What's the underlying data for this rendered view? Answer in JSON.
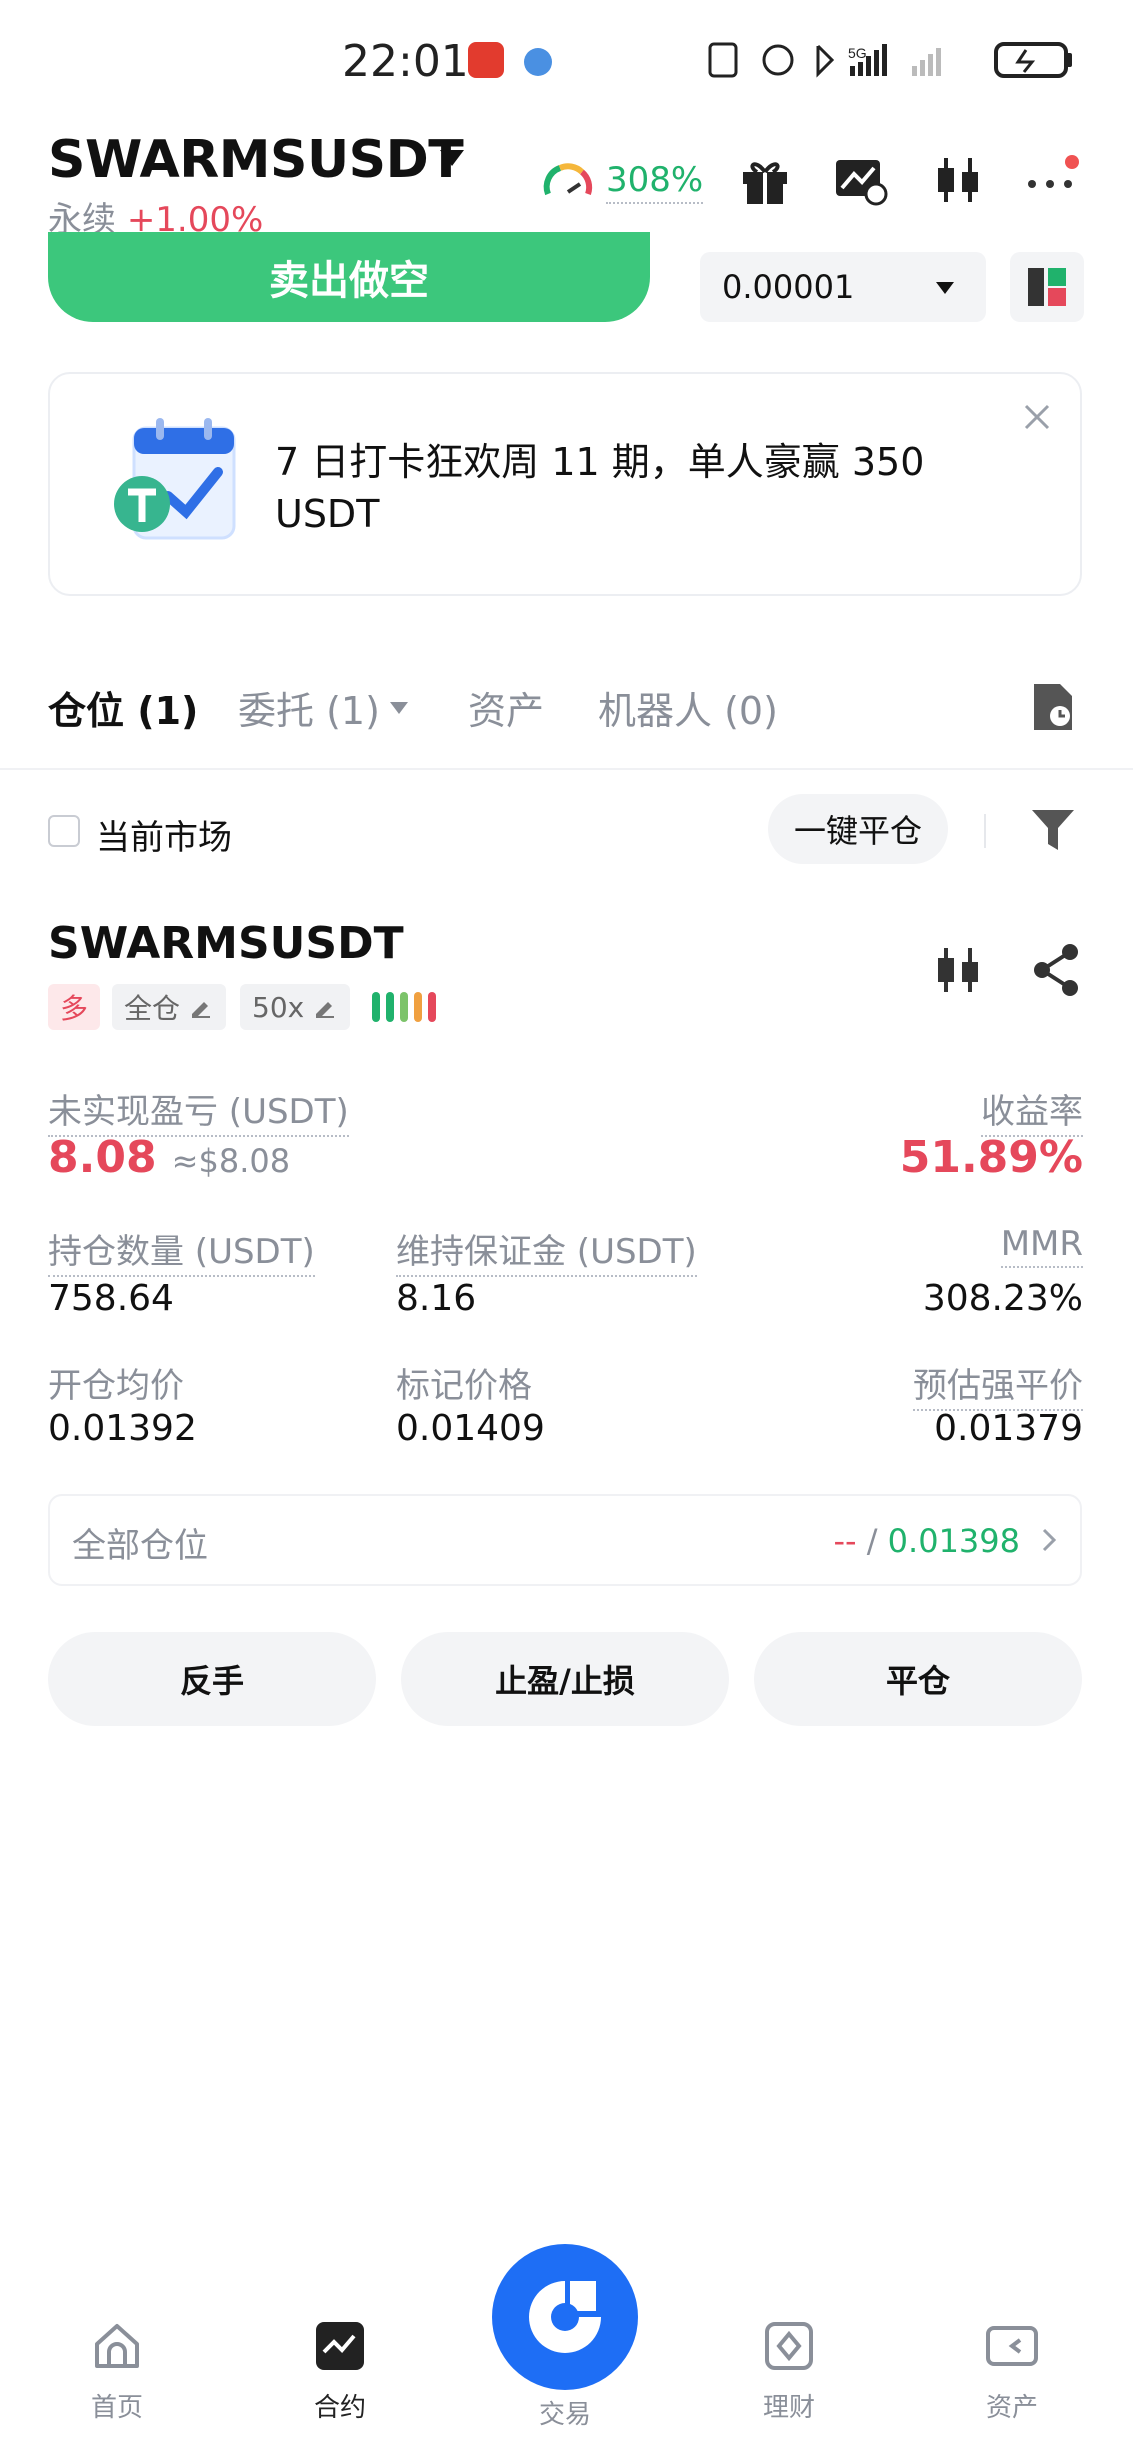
{
  "status_bar": {
    "time": "22:01"
  },
  "header": {
    "pair": "SWARMSUSDT",
    "contract_type": "永续",
    "change": "+1.00%",
    "gauge_value": "308%"
  },
  "order": {
    "sell_label": "卖出做空",
    "step_value": "0.00001"
  },
  "banner": {
    "text": "7 日打卡狂欢周 11 期，单人豪赢 350 USDT"
  },
  "tabs": [
    {
      "label": "仓位 (1)"
    },
    {
      "label": "委托 (1)"
    },
    {
      "label": "资产"
    },
    {
      "label": "机器人 (0)"
    }
  ],
  "filter": {
    "current_market": "当前市场",
    "close_all": "一键平仓"
  },
  "position": {
    "symbol": "SWARMSUSDT",
    "side": "多",
    "margin_mode": "全仓",
    "leverage": "50x",
    "upnl_label": "未实现盈亏 (USDT)",
    "upnl_value": "8.08",
    "upnl_usd": "≈$8.08",
    "roe_label": "收益率",
    "roe_value": "51.89%",
    "size_label": "持仓数量 (USDT)",
    "size_value": "758.64",
    "maint_margin_label": "维持保证金 (USDT)",
    "maint_margin_value": "8.16",
    "mmr_label": "MMR",
    "mmr_value": "308.23%",
    "entry_label": "开仓均价",
    "entry_value": "0.01392",
    "mark_label": "标记价格",
    "mark_value": "0.01409",
    "liq_label": "预估强平价",
    "liq_value": "0.01379"
  },
  "all_positions": {
    "label": "全部仓位",
    "value_left": "--",
    "separator": "/",
    "value_right": "0.01398"
  },
  "actions": {
    "reverse": "反手",
    "tpsl": "止盈/止损",
    "close": "平仓"
  },
  "bottom_nav": [
    {
      "label": "首页",
      "icon": "home-icon"
    },
    {
      "label": "合约",
      "icon": "futures-icon"
    },
    {
      "label": "交易",
      "icon": "trade-icon"
    },
    {
      "label": "理财",
      "icon": "earn-icon"
    },
    {
      "label": "资产",
      "icon": "wallet-icon"
    }
  ],
  "colors": {
    "accent_green": "#3cc77c",
    "red": "#e5485b",
    "green": "#20b26c",
    "orange": "#f39a45",
    "blue": "#1e6ef5"
  }
}
